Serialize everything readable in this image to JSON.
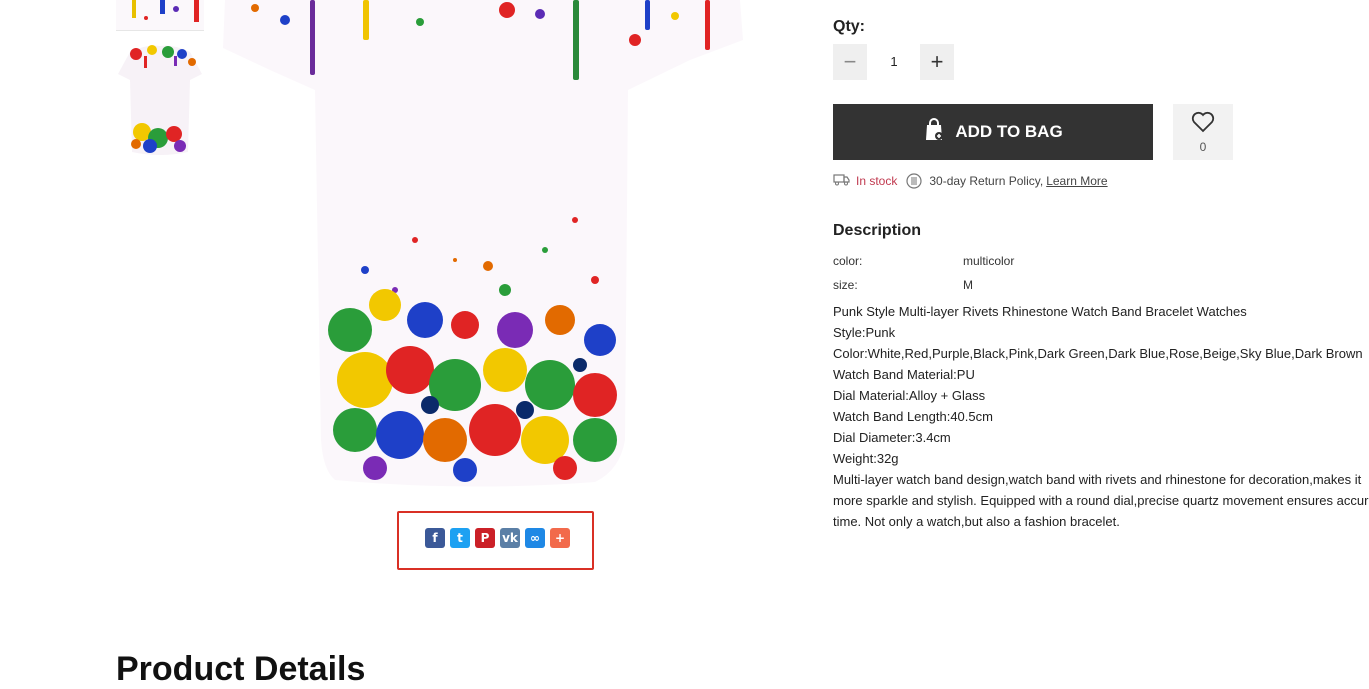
{
  "gallery": {
    "thumbnails": [
      "thumb-top",
      "thumb-front"
    ]
  },
  "share": {
    "icons": [
      {
        "name": "facebook-icon",
        "glyph": "f",
        "color": "#3b5998"
      },
      {
        "name": "twitter-icon",
        "glyph": "t",
        "color": "#1da1f2"
      },
      {
        "name": "pinterest-icon",
        "glyph": "P",
        "color": "#cb2027"
      },
      {
        "name": "vk-icon",
        "glyph": "vk",
        "color": "#5b7fa6"
      },
      {
        "name": "copy-link-icon",
        "glyph": "∞",
        "color": "#1e88e5"
      },
      {
        "name": "more-share-icon",
        "glyph": "+",
        "color": "#f26a4b"
      }
    ]
  },
  "purchase": {
    "qty_label": "Qty:",
    "qty_minus": "−",
    "qty_value": "1",
    "qty_plus": "+",
    "add_to_bag": "ADD TO BAG",
    "wishlist_count": "0",
    "stock_text": "In stock",
    "return_policy": "30-day Return Policy,",
    "learn_more": "Learn More"
  },
  "description": {
    "title": "Description",
    "attributes": [
      {
        "key": "color:",
        "value": "multicolor"
      },
      {
        "key": "size:",
        "value": "M"
      }
    ],
    "lines": [
      "Punk Style Multi-layer Rivets Rhinestone Watch Band Bracelet Watches",
      "Style:Punk",
      "Color:White,Red,Purple,Black,Pink,Dark Green,Dark Blue,Rose,Beige,Sky Blue,Dark Brown",
      "Watch Band Material:PU",
      "Dial Material:Alloy + Glass",
      "Watch Band Length:40.5cm",
      "Dial Diameter:3.4cm",
      "Weight:32g",
      "Multi-layer watch band design,watch band with rivets and rhinestone for decoration,makes it",
      "more sparkle and stylish. Equipped with a round dial,precise quartz movement ensures accurate",
      "time. Not only a watch,but also a fashion bracelet."
    ]
  },
  "section": {
    "title": "Product Details"
  },
  "colors": {
    "accent_dark": "#333333",
    "stock_red": "#c0394f",
    "highlight_border": "#d93025"
  }
}
